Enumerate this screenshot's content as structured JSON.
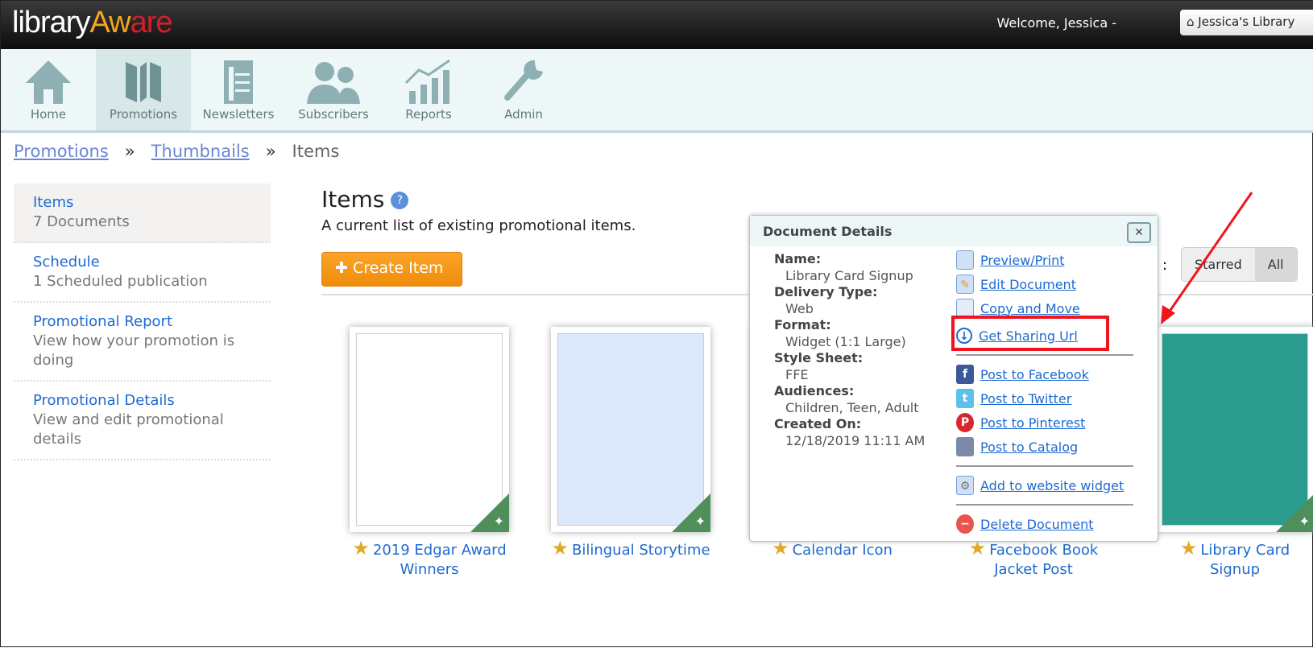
{
  "header": {
    "logo": {
      "part1": "library",
      "part2": "Aw",
      "part3": "are"
    },
    "welcome": "Welcome, Jessica  -",
    "library_button": "Jessica's Library"
  },
  "nav": [
    {
      "label": "Home",
      "icon": "home-icon"
    },
    {
      "label": "Promotions",
      "icon": "map-icon",
      "active": true
    },
    {
      "label": "Newsletters",
      "icon": "newsletter-icon"
    },
    {
      "label": "Subscribers",
      "icon": "users-icon"
    },
    {
      "label": "Reports",
      "icon": "chart-icon"
    },
    {
      "label": "Admin",
      "icon": "wrench-icon"
    }
  ],
  "breadcrumb": [
    {
      "label": "Promotions"
    },
    {
      "label": "Thumbnails"
    },
    {
      "label": "Items"
    }
  ],
  "sidebar": [
    {
      "title": "Items",
      "desc": "7 Documents",
      "active": true
    },
    {
      "title": "Schedule",
      "desc": "1 Scheduled publication"
    },
    {
      "title": "Promotional Report",
      "desc": "View how your promotion is doing"
    },
    {
      "title": "Promotional Details",
      "desc": "View and edit promotional details"
    }
  ],
  "main": {
    "title": "Items",
    "subtitle": "A current list of existing promotional items.",
    "create_button": "Create Item",
    "filter": {
      "starred": "Starred",
      "all": "All",
      "selected": "All"
    }
  },
  "items": [
    {
      "title": "2019 Edgar Award Winners",
      "starred": true,
      "color": "#ffffff"
    },
    {
      "title": "Bilingual Storytime",
      "starred": true,
      "color": "#dce9fb"
    },
    {
      "title": "Calendar Icon",
      "starred": true,
      "color": "#ffffff"
    },
    {
      "title": "Facebook Book Jacket Post",
      "starred": true,
      "color": "#ffffff"
    },
    {
      "title": "Library Card Signup",
      "starred": true,
      "color": "#2a9d8f"
    }
  ],
  "popup": {
    "title": "Document Details",
    "fields": [
      {
        "key": "Name:",
        "value": "Library Card Signup"
      },
      {
        "key": "Delivery Type:",
        "value": "Web"
      },
      {
        "key": "Format:",
        "value": "Widget (1:1 Large)"
      },
      {
        "key": "Style Sheet:",
        "value": "FFE"
      },
      {
        "key": "Audiences:",
        "value": "Children, Teen, Adult"
      },
      {
        "key": "Created On:",
        "value": "12/18/2019 11:11 AM"
      }
    ],
    "actions": {
      "preview": "Preview/Print",
      "edit": "Edit Document",
      "copy": "Copy and Move",
      "share": "Get Sharing Url",
      "facebook": "Post to Facebook",
      "twitter": "Post to Twitter",
      "pinterest": "Post to Pinterest",
      "catalog": "Post to Catalog",
      "widget": "Add to website widget",
      "delete": "Delete Document"
    }
  },
  "colors": {
    "accent": "#f4a51c",
    "link": "#1d6ad0",
    "highlight": "#f0141e"
  }
}
